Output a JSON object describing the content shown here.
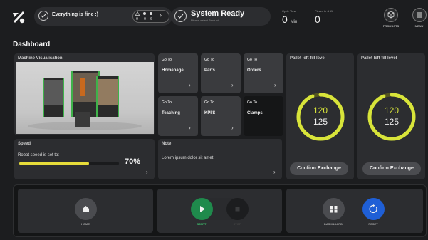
{
  "topbar": {
    "status_text": "Everything is fine :)",
    "mini_counts": [
      "0",
      "0",
      "0"
    ],
    "mini_counts_bottom": [
      "0",
      "0",
      "0"
    ],
    "system_title": "System Ready",
    "system_subtitle": "Please select Product...",
    "cycle_time_label": "Cycle Time",
    "cycle_time_value": "0",
    "cycle_time_unit": "Min",
    "pieces_label": "Pieces in shift",
    "pieces_value": "0",
    "products_label": "PRODUCTS",
    "menu_label": "MENU"
  },
  "page_title": "Dashboard",
  "machine": {
    "title": "Machine Visualisation"
  },
  "tiles": [
    {
      "goto": "Go To",
      "label": "Homepage"
    },
    {
      "goto": "Go To",
      "label": "Parts"
    },
    {
      "goto": "Go To",
      "label": "Orders"
    },
    {
      "goto": "Go To",
      "label": "Teaching"
    },
    {
      "goto": "Go To",
      "label": "KPI'S"
    },
    {
      "goto": "Go To",
      "label": "Clamps"
    }
  ],
  "pallets": [
    {
      "title": "Pallet left fill level",
      "value_top": "120",
      "value_bottom": "125",
      "fill_fraction": 0.94,
      "button": "Confirm Exchange"
    },
    {
      "title": "Pallet left fill level",
      "value_top": "120",
      "value_bottom": "125",
      "fill_fraction": 0.94,
      "button": "Confirm Exchange"
    }
  ],
  "speed": {
    "title": "Speed",
    "caption": "Robot speed is set to:",
    "value_text": "70%",
    "level_fraction": 0.7
  },
  "note": {
    "title": "Note",
    "text": "Lorem ipsum dolor sit amet"
  },
  "bottom": {
    "home_label": "HOME",
    "start_label": "START",
    "stop_label": "STOP",
    "dashboard_label": "DASHBOARD",
    "reset_label": "RESET"
  },
  "colors": {
    "accent_yellow": "#d8e43a",
    "start_green": "#1f8a4c",
    "reset_blue": "#1f5fd6"
  },
  "icons": {
    "logo": "brand-logo-icon",
    "status": "check-circle-icon",
    "products": "box-icon",
    "menu": "hamburger-menu-icon",
    "home": "home-icon",
    "start": "play-icon",
    "stop": "stop-icon",
    "dashboard": "grid-icon",
    "reset": "refresh-icon"
  }
}
